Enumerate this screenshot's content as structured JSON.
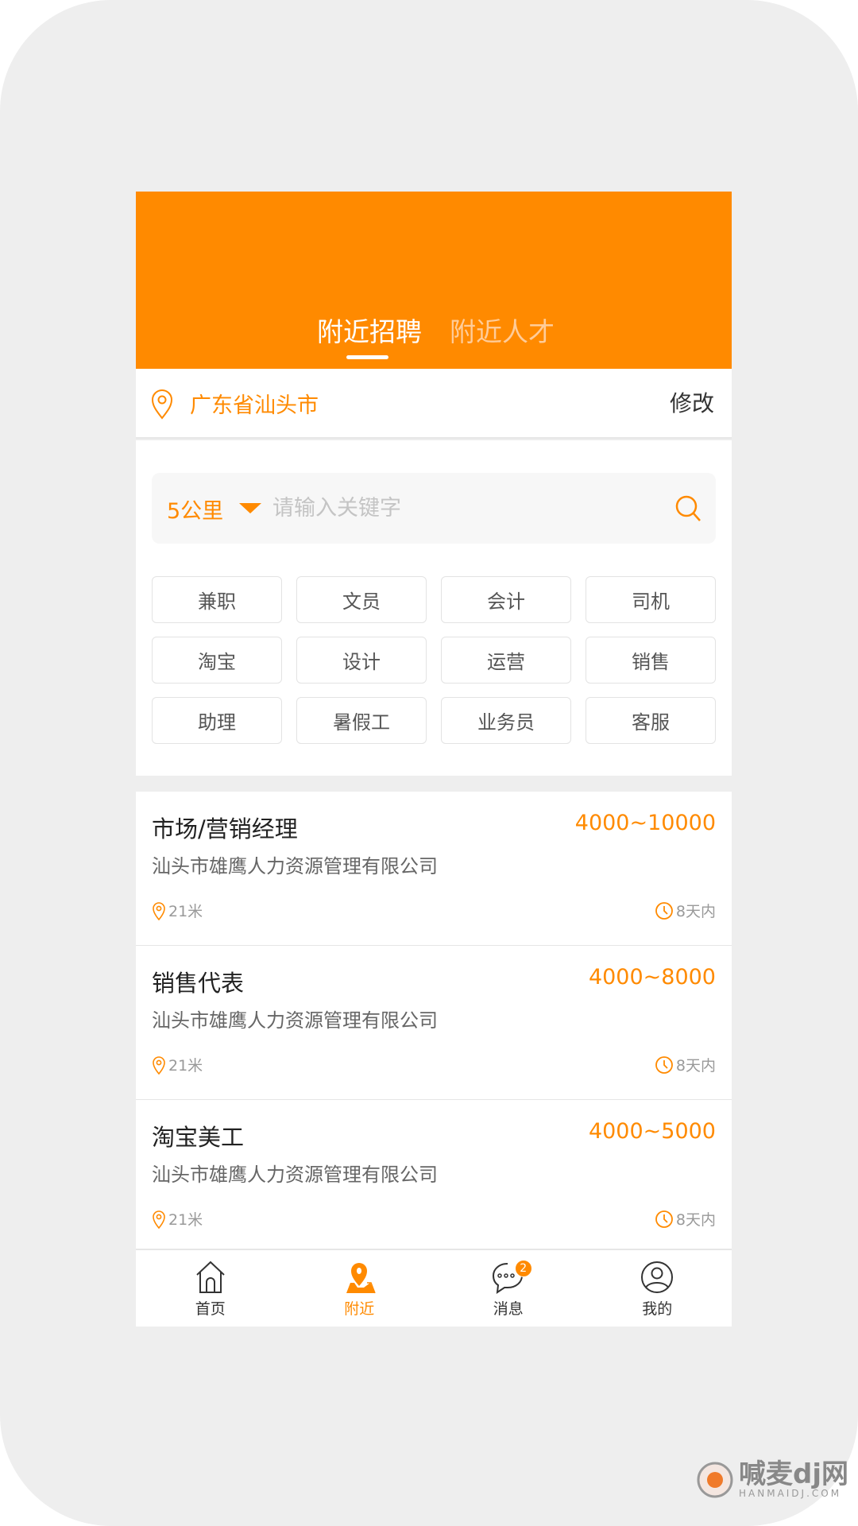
{
  "colors": {
    "accent": "#ff8a00",
    "header_bg": "#ff8a00",
    "page_bg": "#eeeeee"
  },
  "header": {
    "tabs": [
      {
        "label": "附近招聘",
        "active": true
      },
      {
        "label": "附近人才",
        "active": false
      }
    ]
  },
  "location": {
    "icon": "location-pin-icon",
    "value": "广东省汕头市",
    "edit_label": "修改"
  },
  "search": {
    "radius": "5公里",
    "placeholder": "请输入关键字",
    "value": "",
    "icon": "search-icon"
  },
  "tags": [
    "兼职",
    "文员",
    "会计",
    "司机",
    "淘宝",
    "设计",
    "运营",
    "销售",
    "助理",
    "暑假工",
    "业务员",
    "客服"
  ],
  "jobs": [
    {
      "title": "市场/营销经理",
      "salary": "4000~10000",
      "company": "汕头市雄鹰人力资源管理有限公司",
      "distance": "21米",
      "posted": "8天内"
    },
    {
      "title": "销售代表",
      "salary": "4000~8000",
      "company": "汕头市雄鹰人力资源管理有限公司",
      "distance": "21米",
      "posted": "8天内"
    },
    {
      "title": "淘宝美工",
      "salary": "4000~5000",
      "company": "汕头市雄鹰人力资源管理有限公司",
      "distance": "21米",
      "posted": "8天内"
    }
  ],
  "nav": {
    "items": [
      {
        "label": "首页",
        "icon": "home-icon"
      },
      {
        "label": "附近",
        "icon": "map-pin-icon",
        "active": true
      },
      {
        "label": "消息",
        "icon": "chat-icon",
        "badge": "2"
      },
      {
        "label": "我的",
        "icon": "user-icon"
      }
    ]
  },
  "watermark": {
    "text": "喊麦dj网",
    "sub": "HANMAIDJ.COM"
  }
}
